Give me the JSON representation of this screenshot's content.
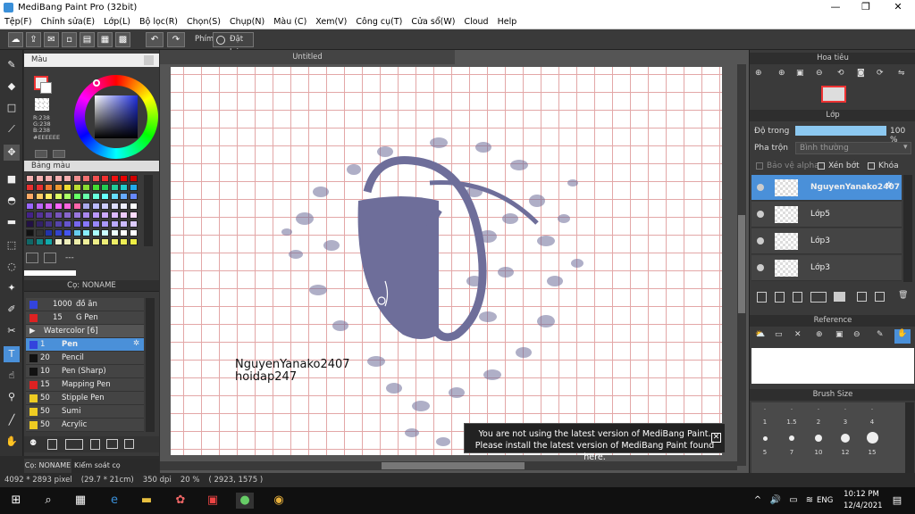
{
  "window": {
    "title": "MediBang Paint Pro (32bit)",
    "minimize": "—",
    "maximize": "❐",
    "close": "✕"
  },
  "menu": [
    "Tệp(F)",
    "Chỉnh sửa(E)",
    "Lớp(L)",
    "Bộ lọc(R)",
    "Chọn(S)",
    "Chụp(N)",
    "Màu (C)",
    "Xem(V)",
    "Công cụ(T)",
    "Cửa sổ(W)",
    "Cloud",
    "Help"
  ],
  "toolbar": {
    "phim": "Phím",
    "reset": "Đặt lại"
  },
  "color_panel": {
    "title": "Màu",
    "r": "R:238",
    "g": "G:238",
    "b": "B:238",
    "hex": "#EEEEEE",
    "palette_title": "Bảng màu",
    "palette_more": "---"
  },
  "brush_panel": {
    "title": "Cọ: NONAME",
    "tabs": [
      "Cọ: NONAME",
      "Kiểm soát cọ"
    ],
    "rows": [
      {
        "size": "1000",
        "name": "đồ ăn",
        "color": "#3344dd"
      },
      {
        "size": "15",
        "name": "G Pen",
        "color": "#dd2222"
      },
      {
        "size": "",
        "name": "Watercolor [6]",
        "color": ""
      },
      {
        "size": "1",
        "name": "Pen",
        "color": "#3344dd"
      },
      {
        "size": "20",
        "name": "Pencil",
        "color": "#111111"
      },
      {
        "size": "10",
        "name": "Pen (Sharp)",
        "color": "#111111"
      },
      {
        "size": "15",
        "name": "Mapping Pen",
        "color": "#dd2222"
      },
      {
        "size": "50",
        "name": "Stipple Pen",
        "color": "#eecc22"
      },
      {
        "size": "50",
        "name": "Sumi",
        "color": "#eecc22"
      },
      {
        "size": "50",
        "name": "Acrylic",
        "color": "#eecc22"
      }
    ]
  },
  "canvas": {
    "tab": "Untitled",
    "text1": "NguyenYanako2407",
    "text2": "hoidap247"
  },
  "notice": {
    "line1": "You are not using the latest version of MediBang Paint.",
    "line2": "Please install the latest version of MediBang Paint found here."
  },
  "navigator": {
    "title": "Hoa tiêu"
  },
  "layer_panel": {
    "title": "Lớp",
    "opacity_label": "Độ trong",
    "opacity_value": "100 %",
    "opacity": 1.0,
    "blend_label": "Pha trộn",
    "blend_value": "Bình thường",
    "alpha_protect": "Bảo vệ alpha",
    "clipping": "Xén bớt",
    "lock": "Khóa",
    "layers": [
      "NguyenYanako2407",
      "Lớp5",
      "Lớp3",
      "Lớp3"
    ]
  },
  "reference": {
    "title": "Reference"
  },
  "brush_size": {
    "title": "Brush Size",
    "sizes": [
      "1",
      "1.5",
      "2",
      "3",
      "4",
      "5",
      "7",
      "10",
      "12",
      "15"
    ]
  },
  "status": {
    "dims": "4092 * 2893 pixel",
    "paper": "(29.7 * 21cm)",
    "dpi": "350 dpi",
    "zoom": "20 %",
    "coords": "( 2923, 1575 )"
  },
  "taskbar": {
    "time": "10:12 PM",
    "date": "12/4/2021",
    "lang": "ENG"
  }
}
